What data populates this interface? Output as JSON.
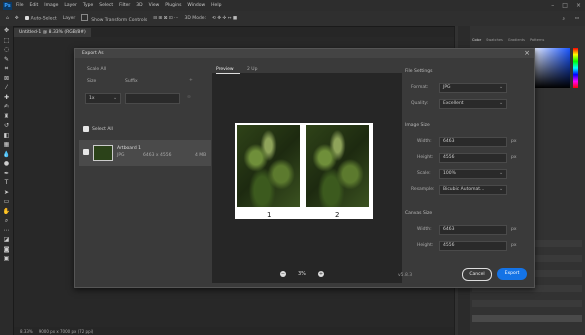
{
  "menubar": {
    "logo": "Ps",
    "items": [
      "File",
      "Edit",
      "Image",
      "Layer",
      "Type",
      "Select",
      "Filter",
      "3D",
      "View",
      "Plugins",
      "Window",
      "Help"
    ]
  },
  "optbar": {
    "auto_select": "Auto-Select",
    "layer": "Layer",
    "show_transform": "Show Transform Controls",
    "threed_mode": "3D Mode:"
  },
  "document": {
    "tab": "Untitled-1 @ 8.33% (RGB/8#)"
  },
  "status": {
    "zoom": "8.33%",
    "doc": "9000 px x 7000 px (72 ppi)"
  },
  "dialog": {
    "title": "Export As",
    "scale_all": "Scale All",
    "size_col": "Size",
    "suffix_col": "Suffix",
    "size_value": "1x",
    "select_all": "Select All",
    "asset_name": "Artboard 1",
    "asset_format": "JPG",
    "asset_dims": "6463 x 4556",
    "asset_size": "4 MB",
    "preview_tab": "Preview",
    "twoup_tab": "2 Up",
    "panel_labels": [
      "1",
      "2"
    ],
    "zoom": "3%",
    "file_settings": "File Settings",
    "format_label": "Format:",
    "format_value": "JPG",
    "quality_label": "Quality:",
    "quality_value": "Excellent",
    "image_size": "Image Size",
    "width_label": "Width:",
    "width_value": "6463",
    "height_label": "Height:",
    "height_value": "4556",
    "scale_label": "Scale:",
    "scale_value": "100%",
    "resample_label": "Resample:",
    "resample_value": "Bicubic Automat...",
    "canvas_size": "Canvas Size",
    "canvas_width": "6463",
    "canvas_height": "4556",
    "unit": "px",
    "version": "v5.8.3",
    "cancel": "Cancel",
    "export": "Export"
  },
  "right_panel": {
    "tabs": [
      "Color",
      "Swatches",
      "Gradients",
      "Patterns"
    ]
  }
}
